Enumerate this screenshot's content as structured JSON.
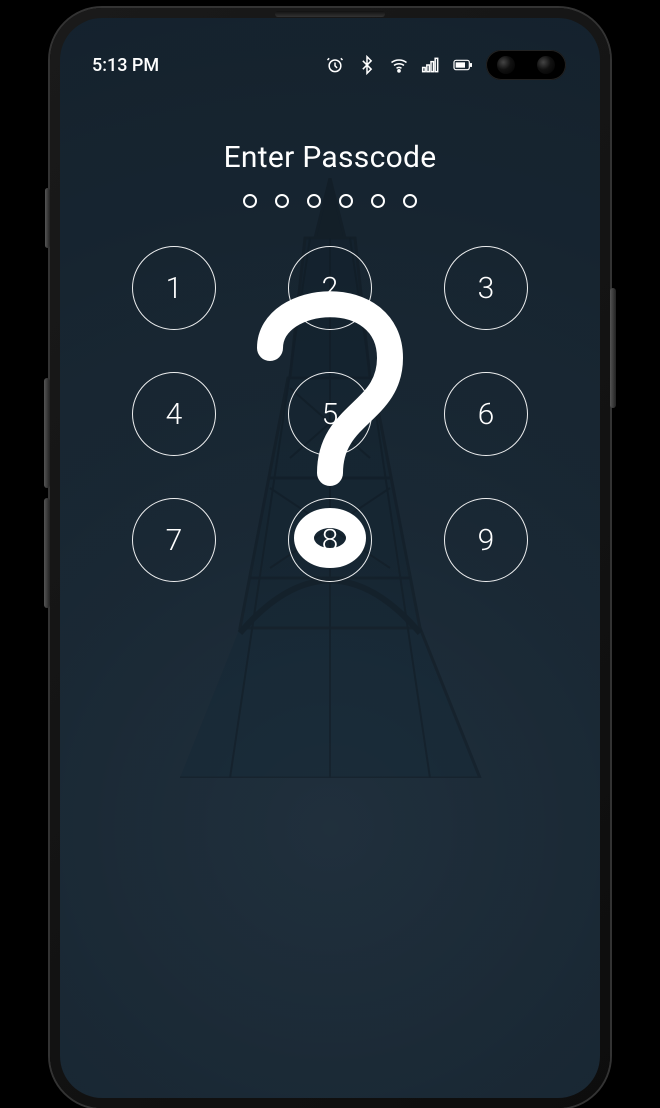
{
  "status_bar": {
    "time": "5:13 PM"
  },
  "lock": {
    "title": "Enter Passcode",
    "passcode_length": 6,
    "keys": [
      "1",
      "2",
      "3",
      "4",
      "5",
      "6",
      "7",
      "8",
      "9"
    ]
  }
}
